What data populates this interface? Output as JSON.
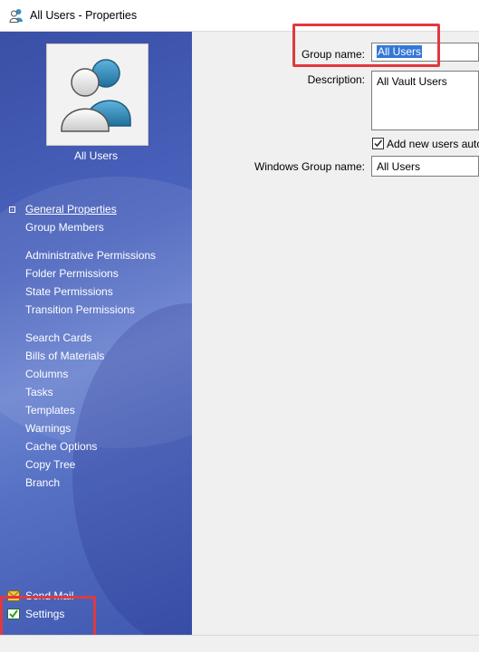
{
  "window": {
    "title": "All Users - Properties"
  },
  "sidebar": {
    "group_label": "All Users",
    "nav_groups": [
      [
        "General Properties",
        "Group Members"
      ],
      [
        "Administrative Permissions",
        "Folder Permissions",
        "State Permissions",
        "Transition Permissions"
      ],
      [
        "Search Cards",
        "Bills of Materials",
        "Columns",
        "Tasks",
        "Templates",
        "Warnings",
        "Cache Options",
        "Copy Tree",
        "Branch"
      ]
    ],
    "bottom": {
      "send_mail": "Send Mail",
      "settings": "Settings"
    }
  },
  "form": {
    "group_name_label": "Group name:",
    "group_name_value": "All Users",
    "description_label": "Description:",
    "description_value": "All Vault Users",
    "checkbox_label": "Add new users auto",
    "checkbox_checked": true,
    "windows_group_label": "Windows Group name:",
    "windows_group_value": "All Users"
  },
  "colors": {
    "highlight": "#e0393e",
    "selection": "#3478d6",
    "sidebar": "#4a63bd"
  }
}
